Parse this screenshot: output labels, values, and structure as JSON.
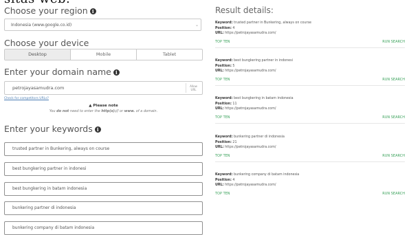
{
  "header_fragment": "sitas web.",
  "region": {
    "heading": "Choose your region",
    "selected": "Indonesia (www.google.co.id)"
  },
  "device": {
    "heading": "Choose your device",
    "options": [
      "Desktop",
      "Mobile",
      "Tablet"
    ],
    "selected": "Desktop"
  },
  "domain": {
    "heading": "Enter your domain name",
    "value": "petrojayasamudra.com",
    "allow_label_1": "Allow",
    "allow_label_2": "URL",
    "competitors_link": "Check for competitors URLs?",
    "note_title": "Please note",
    "note_prefix": "You ",
    "note_bold1": "do not",
    "note_middle": " need to enter the ",
    "note_bold2": "http(s)://",
    "note_or": " or ",
    "note_bold3": "www.",
    "note_suffix": " of a domain."
  },
  "keywords": {
    "heading": "Enter your keywords",
    "items": [
      "trusted partner in Bunkering, always on course",
      "best bungkering partner in indonesi",
      "best bungkering  in batam indonesia",
      "bunkering partner di indonesia",
      "bunkering company di batam indonesia"
    ]
  },
  "results": {
    "heading": "Result details:",
    "keyword_label": "Keyword:",
    "position_label": "Position:",
    "url_label": "URL:",
    "top_ten_label": "TOP TEN",
    "run_search_label": "RUN SEARCH",
    "items": [
      {
        "keyword": "trusted partner in Bunkering, always on course",
        "position": "4",
        "url": "https://petrojayasamudra.com/"
      },
      {
        "keyword": "best bungkering partner in indonesi",
        "position": "5",
        "url": "https://petrojayasamudra.com/"
      },
      {
        "keyword": "best bungkering in batam indonesia",
        "position": "11",
        "url": "https://petrojayasamudra.com/"
      },
      {
        "keyword": "bunkering partner di indonesia",
        "position": "21",
        "url": "https://petrojayasamudra.com/"
      },
      {
        "keyword": "bunkering company di batam indonesia",
        "position": "4",
        "url": "https://petrojayasamudra.com/"
      }
    ]
  },
  "colors": {
    "accent_green": "#3da35d",
    "link_blue": "#4d7fb5"
  },
  "icons": {
    "info": "info-icon",
    "warning": "warning-icon",
    "chevron": "chevron-down-icon"
  }
}
